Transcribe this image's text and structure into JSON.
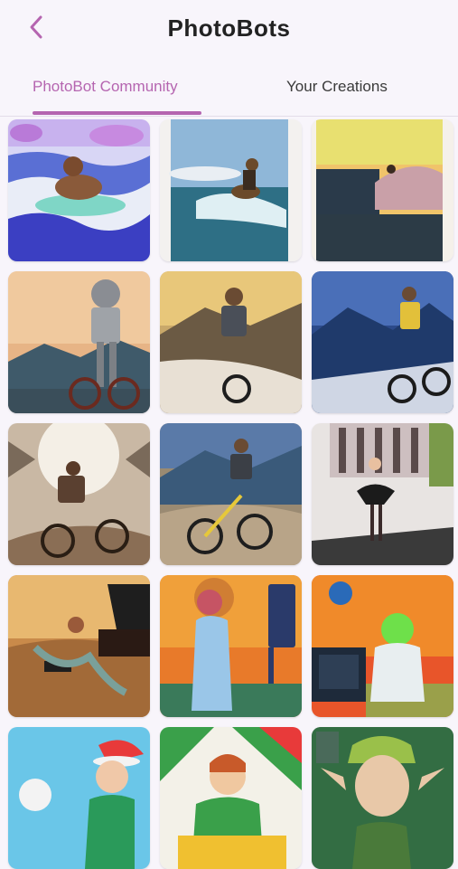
{
  "header": {
    "title": "PhotoBots",
    "back_icon": "chevron-left-icon",
    "accent_color": "#b565b0"
  },
  "tabs": [
    {
      "label": "PhotoBot Community",
      "active": true
    },
    {
      "label": "Your Creations",
      "active": false
    }
  ],
  "gallery": {
    "images": [
      {
        "subject": "man-bodyboarding-on-wave"
      },
      {
        "subject": "man-surfing-wave"
      },
      {
        "subject": "surfer-on-wave-at-sunset"
      },
      {
        "subject": "robot-riding-bicycle"
      },
      {
        "subject": "man-riding-mountain-bike"
      },
      {
        "subject": "man-riding-yellow-bike-mountains"
      },
      {
        "subject": "man-cycling-in-sunburst"
      },
      {
        "subject": "man-riding-yellow-bike-valley"
      },
      {
        "subject": "woman-dancing-in-front-of-building"
      },
      {
        "subject": "mermaid-at-piano-in-desert"
      },
      {
        "subject": "woman-singing-with-microphone"
      },
      {
        "subject": "green-haired-man-holding-globe"
      },
      {
        "subject": "woman-in-elf-hat-with-soccer-ball"
      },
      {
        "subject": "elf-woman-laughing"
      },
      {
        "subject": "elf-portrait"
      }
    ]
  }
}
